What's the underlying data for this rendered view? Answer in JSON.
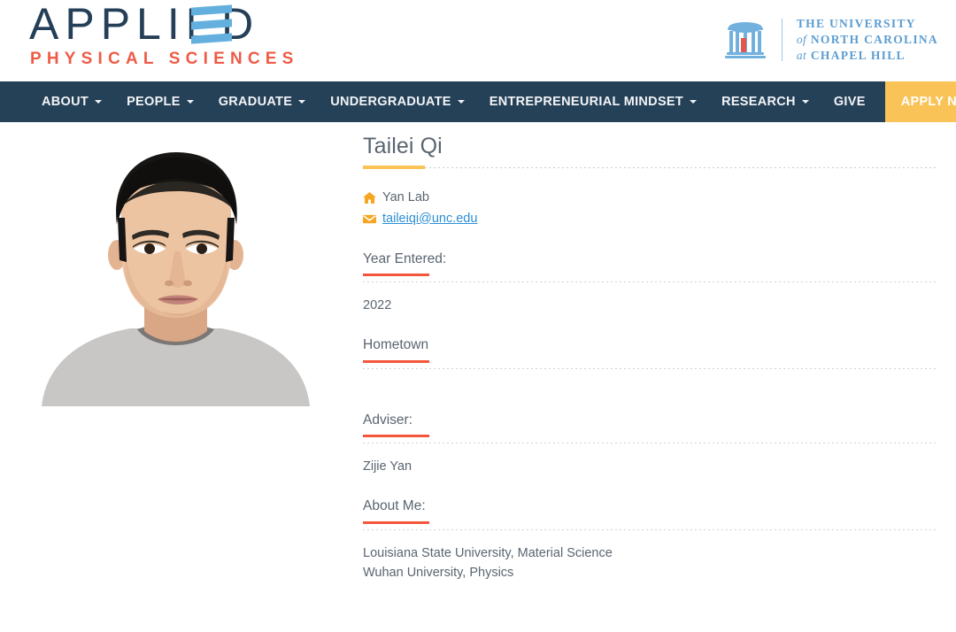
{
  "header": {
    "brand": {
      "title": "APPLIED",
      "subtitle": "PHYSICAL SCIENCES",
      "title_color": "#243f57",
      "accent_color": "#63b0df",
      "subtitle_color": "#ef5b46"
    },
    "university": {
      "line1": "THE UNIVERSITY",
      "line2_prefix": "of",
      "line2": "NORTH CAROLINA",
      "line3_prefix": "at",
      "line3": "CHAPEL HILL",
      "color": "#5b9dd1",
      "mark": "old-well-icon"
    }
  },
  "nav": {
    "background": "#254158",
    "apply_background": "#f9c357",
    "items": [
      {
        "label": "ABOUT",
        "has_dropdown": true
      },
      {
        "label": "PEOPLE",
        "has_dropdown": true
      },
      {
        "label": "GRADUATE",
        "has_dropdown": true
      },
      {
        "label": "UNDERGRADUATE",
        "has_dropdown": true
      },
      {
        "label": "ENTREPRENEURIAL MINDSET",
        "has_dropdown": true
      },
      {
        "label": "RESEARCH",
        "has_dropdown": true
      },
      {
        "label": "GIVE",
        "has_dropdown": false
      }
    ],
    "apply": {
      "label": "APPLY NOW"
    }
  },
  "profile": {
    "photo_alt": "Tailei Qi portrait photo",
    "name": "Tailei Qi",
    "name_underline_color": "#f9c357",
    "lab": {
      "icon": "home-icon",
      "label": "Yan Lab"
    },
    "email": {
      "icon": "envelope-icon",
      "label": "taileiqi@unc.edu",
      "color": "#2d8fd5"
    },
    "section_underline_color": "#f4563c",
    "sections": [
      {
        "heading": "Year Entered:",
        "body": [
          "2022"
        ]
      },
      {
        "heading": "Hometown",
        "body": []
      },
      {
        "heading": "Adviser:",
        "body": [
          "Zijie Yan"
        ]
      },
      {
        "heading": "About Me:",
        "body": [
          "Louisiana State University, Material Science",
          "Wuhan University, Physics"
        ]
      }
    ]
  }
}
